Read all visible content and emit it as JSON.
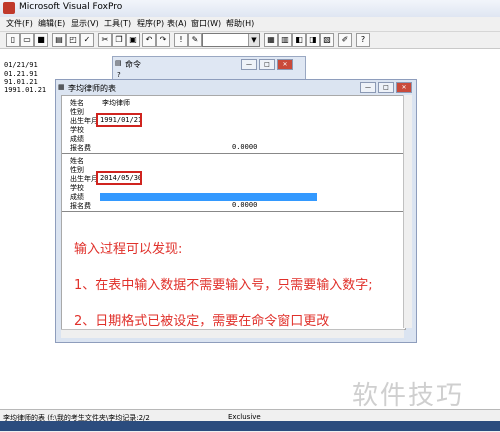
{
  "app": {
    "title": "Microsoft Visual FoxPro"
  },
  "menu": [
    "文件(F)",
    "编辑(E)",
    "显示(V)",
    "工具(T)",
    "程序(P)",
    "表(A)",
    "窗口(W)",
    "帮助(H)"
  ],
  "desktop_lines": [
    "01/21/91",
    "01.21.91",
    "91.01.21",
    "1991.01.21"
  ],
  "command_window": {
    "title": "命令",
    "line": "?"
  },
  "browse_window": {
    "title": "李均律师的表",
    "record1": {
      "name_label": "姓名",
      "name_value": "李均律师",
      "gender_label": "性别",
      "birth_label": "出生年月",
      "birth_value": "1991/01/21",
      "school_label": "学校",
      "score_label": "成绩",
      "fee_label": "报名费",
      "fee_value": "0.0000"
    },
    "record2": {
      "name_label": "姓名",
      "gender_label": "性别",
      "birth_label": "出生年月",
      "birth_value": "2014/05/30",
      "school_label": "学校",
      "score_label": "成绩",
      "fee_label": "报名费",
      "fee_value": "0.0000"
    },
    "notes": [
      "输入过程可以发现:",
      "1、在表中输入数据不需要输入号，只需要输入数字;",
      "2、日期格式已被设定，需要在命令窗口更改"
    ]
  },
  "status": {
    "path": "李均律师的表 (f:\\我的考生文件夹\\李均记录:2/2",
    "mode": "Exclusive"
  },
  "watermark": "软件技巧",
  "colors": {
    "annotation": "#e0302a",
    "selection": "#3399ff"
  }
}
